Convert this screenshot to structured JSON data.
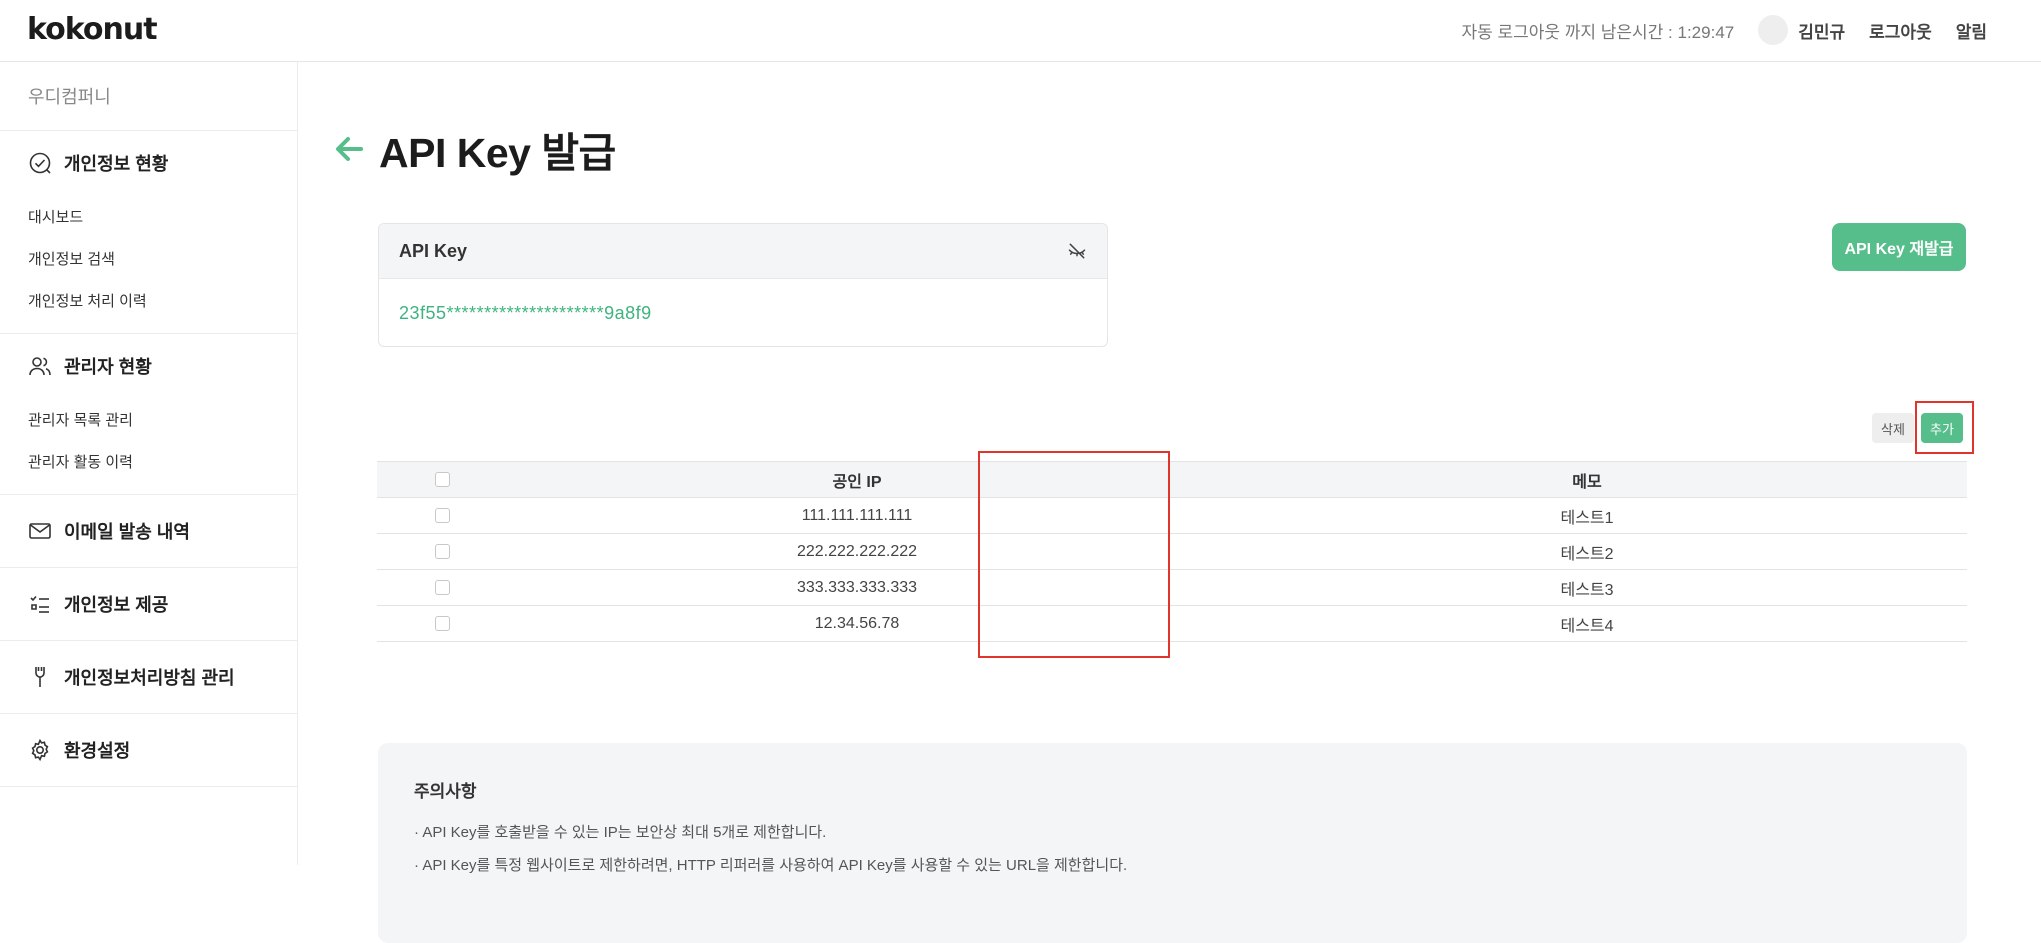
{
  "header": {
    "logo": "kokonut",
    "timer_text": "자동 로그아웃 까지 남은시간 : 1:29:47",
    "user_name": "김민규",
    "logout_label": "로그아웃",
    "alarm_label": "알림"
  },
  "sidebar": {
    "company": "우디컴퍼니",
    "groups": [
      {
        "label": "개인정보 현황",
        "icon": "check-circle-icon",
        "items": [
          "대시보드",
          "개인정보 검색",
          "개인정보 처리 이력"
        ]
      },
      {
        "label": "관리자 현황",
        "icon": "users-icon",
        "items": [
          "관리자 목록 관리",
          "관리자 활동 이력"
        ]
      },
      {
        "label": "이메일 발송 내역",
        "icon": "mail-icon",
        "items": []
      },
      {
        "label": "개인정보 제공",
        "icon": "checklist-icon",
        "items": []
      },
      {
        "label": "개인정보처리방침 관리",
        "icon": "tool-icon",
        "items": []
      },
      {
        "label": "환경설정",
        "icon": "gear-icon",
        "items": []
      }
    ]
  },
  "page": {
    "title": "API Key 발급",
    "key_card_title": "API Key",
    "key_value": "23f55*********************9a8f9",
    "reissue_label": "API Key 재발급",
    "delete_label": "삭제",
    "add_label": "추가"
  },
  "table": {
    "headers": [
      "공인 IP",
      "메모"
    ],
    "rows": [
      {
        "ip": "111.111.111.111",
        "memo": "테스트1"
      },
      {
        "ip": "222.222.222.222",
        "memo": "테스트2"
      },
      {
        "ip": "333.333.333.333",
        "memo": "테스트3"
      },
      {
        "ip": "12.34.56.78",
        "memo": "테스트4"
      }
    ]
  },
  "notice": {
    "title": "주의사항",
    "lines": [
      "· API Key를 호출받을 수 있는 IP는 보안상 최대 5개로 제한합니다.",
      "· API Key를 특정 웹사이트로 제한하려면, HTTP 리퍼러를 사용하여 API Key를 사용할 수 있는 URL을 제한합니다."
    ]
  },
  "colors": {
    "accent": "#55be8a",
    "key_text": "#3fb37f",
    "highlight": "#e0352b"
  }
}
